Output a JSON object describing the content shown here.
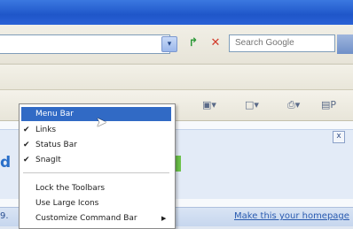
{
  "toolbar": {
    "search_placeholder": "Search Google",
    "dropdown_icon": "▾",
    "go_icon": "↱",
    "stop_icon": "✕"
  },
  "command_bar": {
    "icons": [
      "page-icon",
      "minimize-icon",
      "print-icon",
      "page-menu-icon"
    ],
    "page_label": "P"
  },
  "context_menu": {
    "items": [
      {
        "label": "Menu Bar",
        "checked": false,
        "highlighted": true
      },
      {
        "label": "Links",
        "checked": true
      },
      {
        "label": "Status Bar",
        "checked": true
      },
      {
        "label": "SnagIt",
        "checked": true
      },
      {
        "label": "Lock the Toolbars",
        "checked": false
      },
      {
        "label": "Use Large Icons",
        "checked": false
      },
      {
        "label": "Customize Command Bar",
        "checked": false,
        "submenu": true
      }
    ]
  },
  "infobar": {
    "close_icon": "x",
    "partial_text": "d"
  },
  "bottom": {
    "left_text": "9.",
    "homepage_link": "Make this your homepage"
  },
  "colors": {
    "titlebar": "#1f56c9",
    "highlight": "#316ac5",
    "link": "#2a5bb0"
  }
}
